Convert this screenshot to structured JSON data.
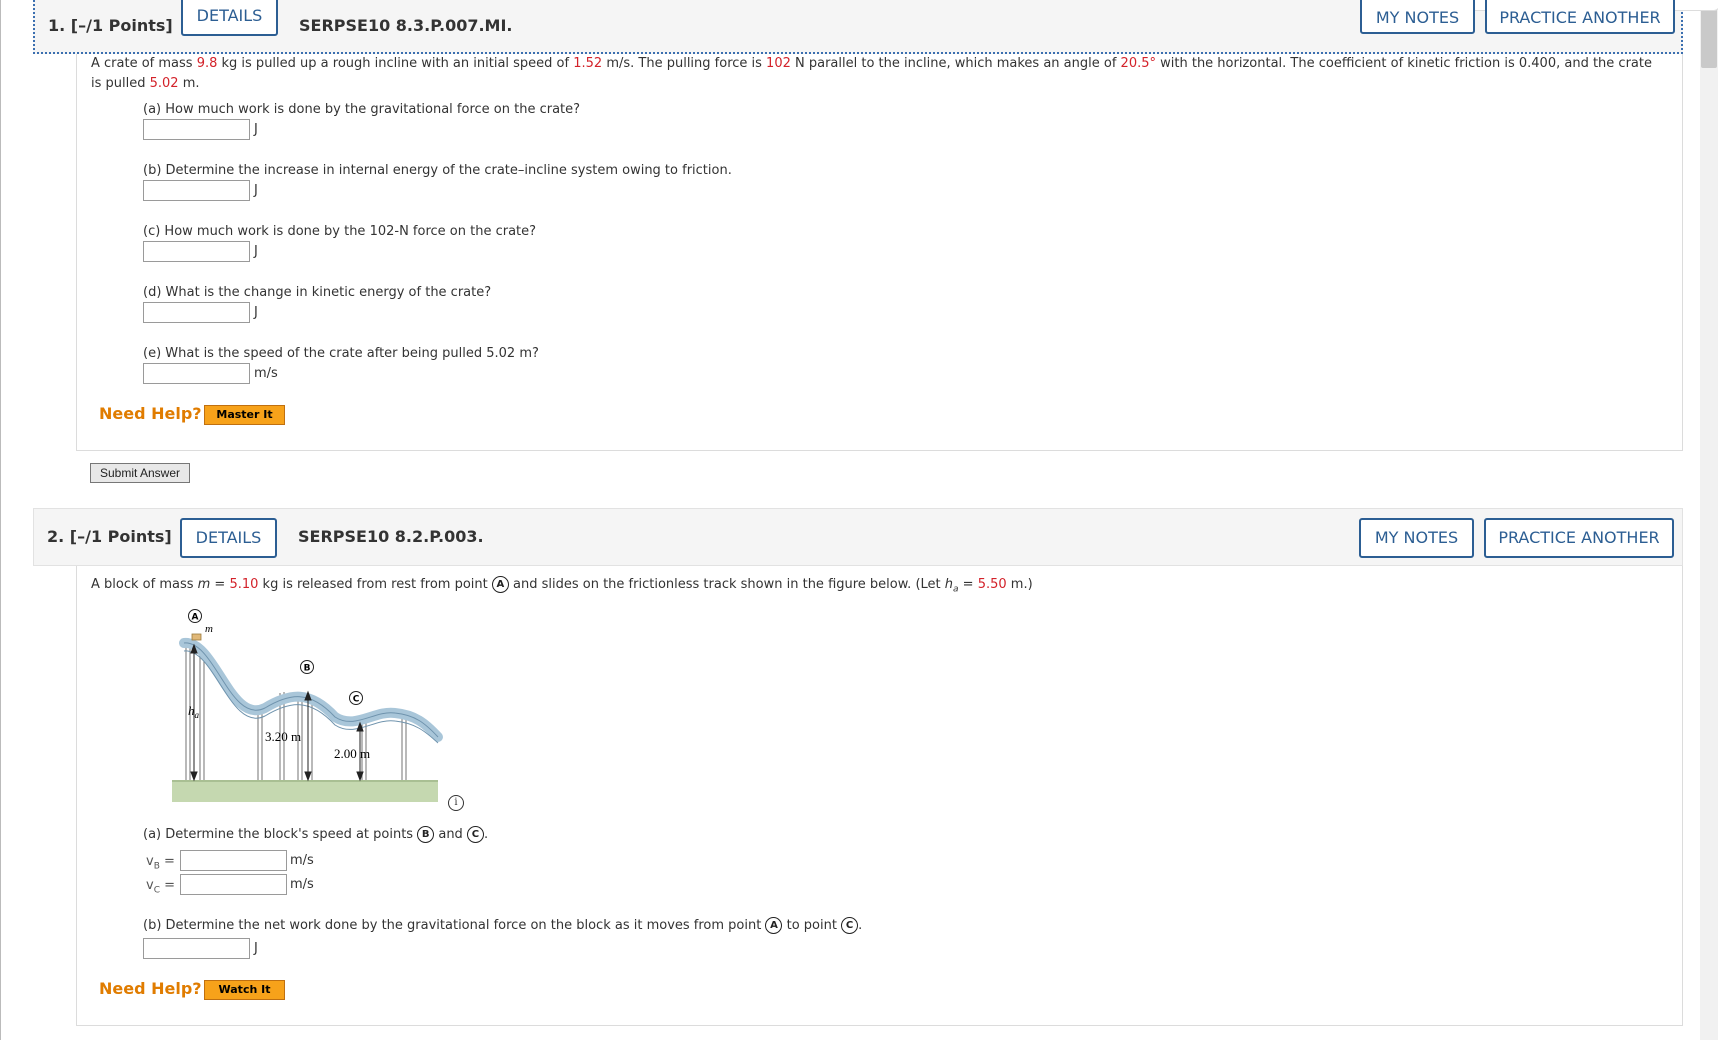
{
  "q1": {
    "number": "1. [–/1 Points]",
    "details_label": "DETAILS",
    "code": "SERPSE10 8.3.P.007.MI.",
    "my_notes_label": "MY NOTES",
    "practice_label": "PRACTICE ANOTHER",
    "prompt": {
      "t1": "A crate of mass ",
      "mass": "9.8",
      "t2": " kg is pulled up a rough incline with an initial speed of ",
      "speed": "1.52",
      "t3": " m/s. The pulling force is ",
      "force": "102",
      "t4": " N parallel to the incline, which makes an angle of ",
      "angle": "20.5°",
      "t5": " with the horizontal. The coefficient of kinetic friction is 0.400, and the crate",
      "t6": "is pulled ",
      "dist": "5.02",
      "t7": " m."
    },
    "parts": [
      {
        "q": "(a) How much work is done by the gravitational force on the crate?",
        "unit": "J"
      },
      {
        "q": "(b) Determine the increase in internal energy of the crate–incline system owing to friction.",
        "unit": "J"
      },
      {
        "q": "(c) How much work is done by the 102-N force on the crate?",
        "unit": "J"
      },
      {
        "q": "(d) What is the change in kinetic energy of the crate?",
        "unit": "J"
      },
      {
        "q": "(e) What is the speed of the crate after being pulled 5.02 m?",
        "unit": "m/s"
      }
    ],
    "need_help": "Need Help?",
    "help_button": "Master It",
    "submit_label": "Submit Answer"
  },
  "q2": {
    "number": "2. [–/1 Points]",
    "details_label": "DETAILS",
    "code": "SERPSE10 8.2.P.003.",
    "my_notes_label": "MY NOTES",
    "practice_label": "PRACTICE ANOTHER",
    "prompt": {
      "t1": "A block of mass ",
      "m_var": "m",
      "t2": " = ",
      "mass": "5.10",
      "t3": " kg is released from rest from point ",
      "point_a": "A",
      "t4": " and slides on the frictionless track shown in the figure below. (Let ",
      "h_var": "h",
      "h_sub": "a",
      "t5": " = ",
      "height": "5.50",
      "t6": " m.)"
    },
    "figure": {
      "label_a": "A",
      "label_b": "B",
      "label_c": "C",
      "label_m": "m",
      "label_h": "h",
      "label_h_sub": "a",
      "label_320": "3.20 m",
      "label_200": "2.00 m",
      "info_icon": "i"
    },
    "part_a": {
      "t1": "(a) Determine the block's speed at points ",
      "pb": "B",
      "t2": " and ",
      "pc": "C",
      "t3": ".",
      "vb_label": "v",
      "vb_sub": "B",
      "vc_label": "v",
      "vc_sub": "C",
      "eq": " =",
      "unit": "m/s"
    },
    "part_b": {
      "t1": "(b) Determine the net work done by the gravitational force on the block as it moves from point ",
      "pa": "A",
      "t2": " to point ",
      "pc": "C",
      "t3": ".",
      "unit": "J"
    },
    "need_help": "Need Help?",
    "help_button": "Watch It"
  }
}
